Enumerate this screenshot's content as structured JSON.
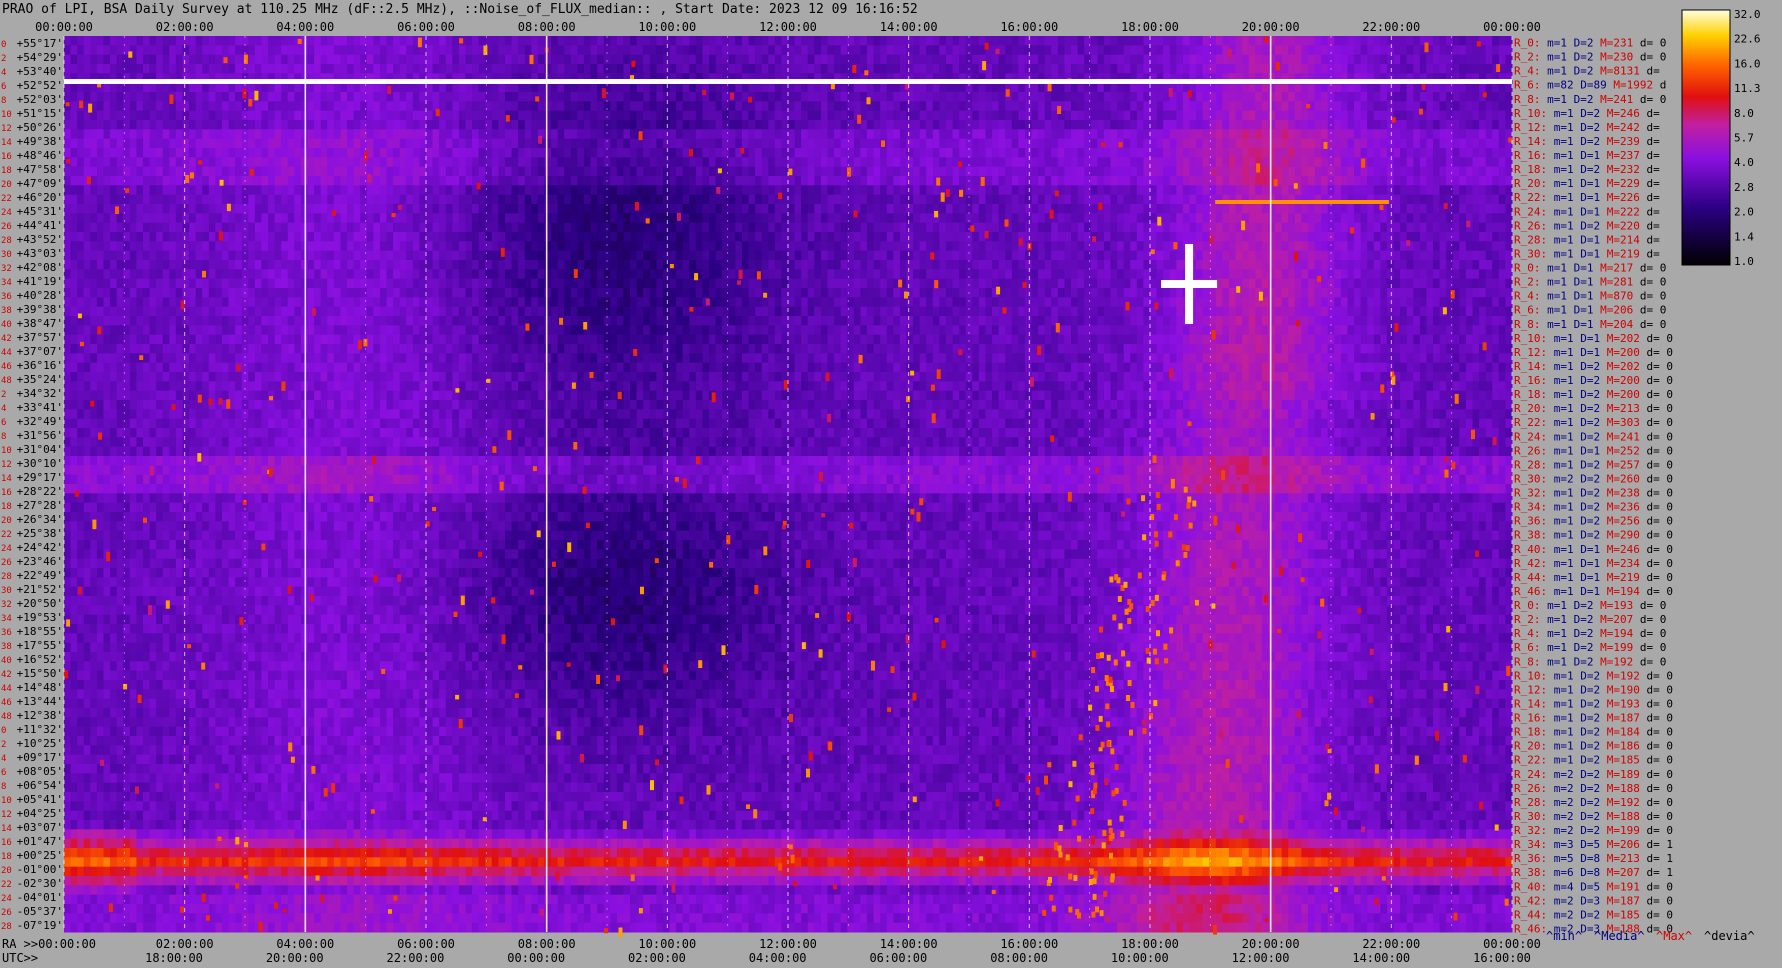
{
  "title": "PRAO of LPI, BSA Daily Survey at 110.25 MHz (dF::2.5 MHz), ::Noise_of_FLUX_median:: , Start Date: 2023 12 09 16:16:52",
  "chart_data": {
    "type": "heatmap",
    "title": "PRAO of LPI, BSA Daily Survey at 110.25 MHz (dF::2.5 MHz), ::Noise_of_FLUX_median:: , Start Date: 2023 12 09 16:16:52",
    "x_ra_ticks": [
      "00:00:00",
      "02:00:00",
      "04:00:00",
      "06:00:00",
      "08:00:00",
      "10:00:00",
      "12:00:00",
      "14:00:00",
      "16:00:00",
      "18:00:00",
      "20:00:00",
      "22:00:00",
      "00:00:00"
    ],
    "x_ra_bottom_ticks": [
      "RA >>00:00:00",
      "02:00:00",
      "04:00:00",
      "06:00:00",
      "08:00:00",
      "10:00:00",
      "12:00:00",
      "14:00:00",
      "16:00:00",
      "18:00:00",
      "20:00:00",
      "22:00:00",
      "00:00:00"
    ],
    "x_utc_ticks": [
      "UTC>>",
      "18:00:00",
      "20:00:00",
      "22:00:00",
      "00:00:00",
      "02:00:00",
      "04:00:00",
      "06:00:00",
      "08:00:00",
      "10:00:00",
      "12:00:00",
      "14:00:00",
      "16:00:00"
    ],
    "dec_labels": [
      "+55°17'",
      "+54°29'",
      "+53°40'",
      "+52°52'",
      "+52°03'",
      "+51°15'",
      "+50°26'",
      "+49°38'",
      "+48°46'",
      "+47°58'",
      "+47°09'",
      "+46°20'",
      "+45°31'",
      "+44°41'",
      "+43°52'",
      "+43°03'",
      "+42°08'",
      "+41°19'",
      "+40°28'",
      "+39°38'",
      "+38°47'",
      "+37°57'",
      "+37°07'",
      "+36°16'",
      "+35°24'",
      "+34°32'",
      "+33°41'",
      "+32°49'",
      "+31°56'",
      "+31°04'",
      "+30°10'",
      "+29°17'",
      "+28°22'",
      "+27°28'",
      "+26°34'",
      "+25°38'",
      "+24°42'",
      "+23°46'",
      "+22°49'",
      "+21°52'",
      "+20°50'",
      "+19°53'",
      "+18°55'",
      "+17°55'",
      "+16°52'",
      "+15°50'",
      "+14°48'",
      "+13°44'",
      "+12°38'",
      "+11°32'",
      "+10°25'",
      "+09°17'",
      "+08°05'",
      "+06°54'",
      "+05°41'",
      "+04°25'",
      "+03°07'",
      "+01°47'",
      "+00°25'",
      "-01°00'",
      "-02°30'",
      "-04°01'",
      "-05°37'",
      "-07°19'"
    ],
    "row_numbers": [
      "0",
      "2",
      "4",
      "6",
      "8",
      "10",
      "12",
      "14",
      "16",
      "18",
      "20",
      "22",
      "24",
      "26",
      "28",
      "30",
      "32",
      "34",
      "36",
      "38",
      "40",
      "42",
      "44",
      "46",
      "48",
      "2",
      "4",
      "6",
      "8",
      "10",
      "12",
      "14",
      "16",
      "18",
      "20",
      "22",
      "24",
      "26",
      "28",
      "30",
      "32",
      "34",
      "36",
      "38",
      "40",
      "42",
      "44",
      "46",
      "48",
      "0",
      "2",
      "4",
      "6",
      "8",
      "10",
      "12",
      "14",
      "16",
      "18",
      "20",
      "22",
      "24",
      "26",
      "28"
    ],
    "colorbar": {
      "ticks": [
        "32.0",
        "22.6",
        "16.0",
        "11.3",
        "8.0",
        "5.7",
        "4.0",
        "2.8",
        "2.0",
        "1.4",
        "1.0"
      ],
      "range": [
        1.0,
        32.0
      ],
      "colormap": "gnuplot"
    },
    "legend": {
      "min": "^min^",
      "median": "^Media^",
      "max": "^Max^",
      "devia": "^devia^"
    },
    "row_stats": [
      {
        "r": "R_0:",
        "m": "m=1",
        "d": "D=2",
        "max": "M=231",
        "dv": "d= 0"
      },
      {
        "r": "R_2:",
        "m": "m=1",
        "d": "D=2",
        "max": "M=230",
        "dv": "d= 0"
      },
      {
        "r": "R_4:",
        "m": "m=1",
        "d": "D=2",
        "max": "M=8131",
        "dv": "d="
      },
      {
        "r": "R_6:",
        "m": "m=82",
        "d": "D=89",
        "max": "M=1992",
        "dv": "d"
      },
      {
        "r": "R_8:",
        "m": "m=1",
        "d": "D=2",
        "max": "M=241",
        "dv": "d= 0"
      },
      {
        "r": "R_10:",
        "m": "m=1",
        "d": "D=2",
        "max": "M=246",
        "dv": "d="
      },
      {
        "r": "R_12:",
        "m": "m=1",
        "d": "D=2",
        "max": "M=242",
        "dv": "d="
      },
      {
        "r": "R_14:",
        "m": "m=1",
        "d": "D=2",
        "max": "M=239",
        "dv": "d="
      },
      {
        "r": "R_16:",
        "m": "m=1",
        "d": "D=1",
        "max": "M=237",
        "dv": "d="
      },
      {
        "r": "R_18:",
        "m": "m=1",
        "d": "D=2",
        "max": "M=232",
        "dv": "d="
      },
      {
        "r": "R_20:",
        "m": "m=1",
        "d": "D=1",
        "max": "M=229",
        "dv": "d="
      },
      {
        "r": "R_22:",
        "m": "m=1",
        "d": "D=1",
        "max": "M=226",
        "dv": "d="
      },
      {
        "r": "R_24:",
        "m": "m=1",
        "d": "D=1",
        "max": "M=222",
        "dv": "d="
      },
      {
        "r": "R_26:",
        "m": "m=1",
        "d": "D=2",
        "max": "M=220",
        "dv": "d="
      },
      {
        "r": "R_28:",
        "m": "m=1",
        "d": "D=1",
        "max": "M=214",
        "dv": "d="
      },
      {
        "r": "R_30:",
        "m": "m=1",
        "d": "D=1",
        "max": "M=219",
        "dv": "d="
      },
      {
        "r": "R_0:",
        "m": "m=1",
        "d": "D=1",
        "max": "M=217",
        "dv": "d= 0"
      },
      {
        "r": "R_2:",
        "m": "m=1",
        "d": "D=1",
        "max": "M=281",
        "dv": "d= 0"
      },
      {
        "r": "R_4:",
        "m": "m=1",
        "d": "D=1",
        "max": "M=870",
        "dv": "d= 0"
      },
      {
        "r": "R_6:",
        "m": "m=1",
        "d": "D=1",
        "max": "M=206",
        "dv": "d= 0"
      },
      {
        "r": "R_8:",
        "m": "m=1",
        "d": "D=1",
        "max": "M=204",
        "dv": "d= 0"
      },
      {
        "r": "R_10:",
        "m": "m=1",
        "d": "D=1",
        "max": "M=202",
        "dv": "d= 0"
      },
      {
        "r": "R_12:",
        "m": "m=1",
        "d": "D=1",
        "max": "M=200",
        "dv": "d= 0"
      },
      {
        "r": "R_14:",
        "m": "m=1",
        "d": "D=2",
        "max": "M=202",
        "dv": "d= 0"
      },
      {
        "r": "R_16:",
        "m": "m=1",
        "d": "D=2",
        "max": "M=200",
        "dv": "d= 0"
      },
      {
        "r": "R_18:",
        "m": "m=1",
        "d": "D=2",
        "max": "M=200",
        "dv": "d= 0"
      },
      {
        "r": "R_20:",
        "m": "m=1",
        "d": "D=2",
        "max": "M=213",
        "dv": "d= 0"
      },
      {
        "r": "R_22:",
        "m": "m=1",
        "d": "D=2",
        "max": "M=303",
        "dv": "d= 0"
      },
      {
        "r": "R_24:",
        "m": "m=1",
        "d": "D=2",
        "max": "M=241",
        "dv": "d= 0"
      },
      {
        "r": "R_26:",
        "m": "m=1",
        "d": "D=1",
        "max": "M=252",
        "dv": "d= 0"
      },
      {
        "r": "R_28:",
        "m": "m=1",
        "d": "D=2",
        "max": "M=257",
        "dv": "d= 0"
      },
      {
        "r": "R_30:",
        "m": "m=2",
        "d": "D=2",
        "max": "M=260",
        "dv": "d= 0"
      },
      {
        "r": "R_32:",
        "m": "m=1",
        "d": "D=2",
        "max": "M=238",
        "dv": "d= 0"
      },
      {
        "r": "R_34:",
        "m": "m=1",
        "d": "D=2",
        "max": "M=236",
        "dv": "d= 0"
      },
      {
        "r": "R_36:",
        "m": "m=1",
        "d": "D=2",
        "max": "M=256",
        "dv": "d= 0"
      },
      {
        "r": "R_38:",
        "m": "m=1",
        "d": "D=2",
        "max": "M=290",
        "dv": "d= 0"
      },
      {
        "r": "R_40:",
        "m": "m=1",
        "d": "D=1",
        "max": "M=246",
        "dv": "d= 0"
      },
      {
        "r": "R_42:",
        "m": "m=1",
        "d": "D=1",
        "max": "M=234",
        "dv": "d= 0"
      },
      {
        "r": "R_44:",
        "m": "m=1",
        "d": "D=1",
        "max": "M=219",
        "dv": "d= 0"
      },
      {
        "r": "R_46:",
        "m": "m=1",
        "d": "D=1",
        "max": "M=194",
        "dv": "d= 0"
      },
      {
        "r": "R_0:",
        "m": "m=1",
        "d": "D=2",
        "max": "M=193",
        "dv": "d= 0"
      },
      {
        "r": "R_2:",
        "m": "m=1",
        "d": "D=2",
        "max": "M=207",
        "dv": "d= 0"
      },
      {
        "r": "R_4:",
        "m": "m=1",
        "d": "D=2",
        "max": "M=194",
        "dv": "d= 0"
      },
      {
        "r": "R_6:",
        "m": "m=1",
        "d": "D=2",
        "max": "M=199",
        "dv": "d= 0"
      },
      {
        "r": "R_8:",
        "m": "m=1",
        "d": "D=2",
        "max": "M=192",
        "dv": "d= 0"
      },
      {
        "r": "R_10:",
        "m": "m=1",
        "d": "D=2",
        "max": "M=192",
        "dv": "d= 0"
      },
      {
        "r": "R_12:",
        "m": "m=1",
        "d": "D=2",
        "max": "M=190",
        "dv": "d= 0"
      },
      {
        "r": "R_14:",
        "m": "m=1",
        "d": "D=2",
        "max": "M=193",
        "dv": "d= 0"
      },
      {
        "r": "R_16:",
        "m": "m=1",
        "d": "D=2",
        "max": "M=187",
        "dv": "d= 0"
      },
      {
        "r": "R_18:",
        "m": "m=1",
        "d": "D=2",
        "max": "M=184",
        "dv": "d= 0"
      },
      {
        "r": "R_20:",
        "m": "m=1",
        "d": "D=2",
        "max": "M=186",
        "dv": "d= 0"
      },
      {
        "r": "R_22:",
        "m": "m=1",
        "d": "D=2",
        "max": "M=185",
        "dv": "d= 0"
      },
      {
        "r": "R_24:",
        "m": "m=2",
        "d": "D=2",
        "max": "M=189",
        "dv": "d= 0"
      },
      {
        "r": "R_26:",
        "m": "m=2",
        "d": "D=2",
        "max": "M=188",
        "dv": "d= 0"
      },
      {
        "r": "R_28:",
        "m": "m=2",
        "d": "D=2",
        "max": "M=192",
        "dv": "d= 0"
      },
      {
        "r": "R_30:",
        "m": "m=2",
        "d": "D=2",
        "max": "M=188",
        "dv": "d= 0"
      },
      {
        "r": "R_32:",
        "m": "m=2",
        "d": "D=2",
        "max": "M=199",
        "dv": "d= 0"
      },
      {
        "r": "R_34:",
        "m": "m=3",
        "d": "D=5",
        "max": "M=206",
        "dv": "d= 1"
      },
      {
        "r": "R_36:",
        "m": "m=5",
        "d": "D=8",
        "max": "M=213",
        "dv": "d= 1"
      },
      {
        "r": "R_38:",
        "m": "m=6",
        "d": "D=8",
        "max": "M=207",
        "dv": "d= 1"
      },
      {
        "r": "R_40:",
        "m": "m=4",
        "d": "D=5",
        "max": "M=191",
        "dv": "d= 0"
      },
      {
        "r": "R_42:",
        "m": "m=2",
        "d": "D=3",
        "max": "M=187",
        "dv": "d= 0"
      },
      {
        "r": "R_44:",
        "m": "m=2",
        "d": "D=2",
        "max": "M=185",
        "dv": "d= 0"
      },
      {
        "r": "R_46:",
        "m": "m=2",
        "d": "D=3",
        "max": "M=188",
        "dv": "d= 0"
      }
    ]
  },
  "colors": {
    "background": "#a9a9a9",
    "stat_label": "#d00000",
    "stat_value": "#000080",
    "legend_blue": "#000080",
    "legend_red": "#d00000"
  }
}
